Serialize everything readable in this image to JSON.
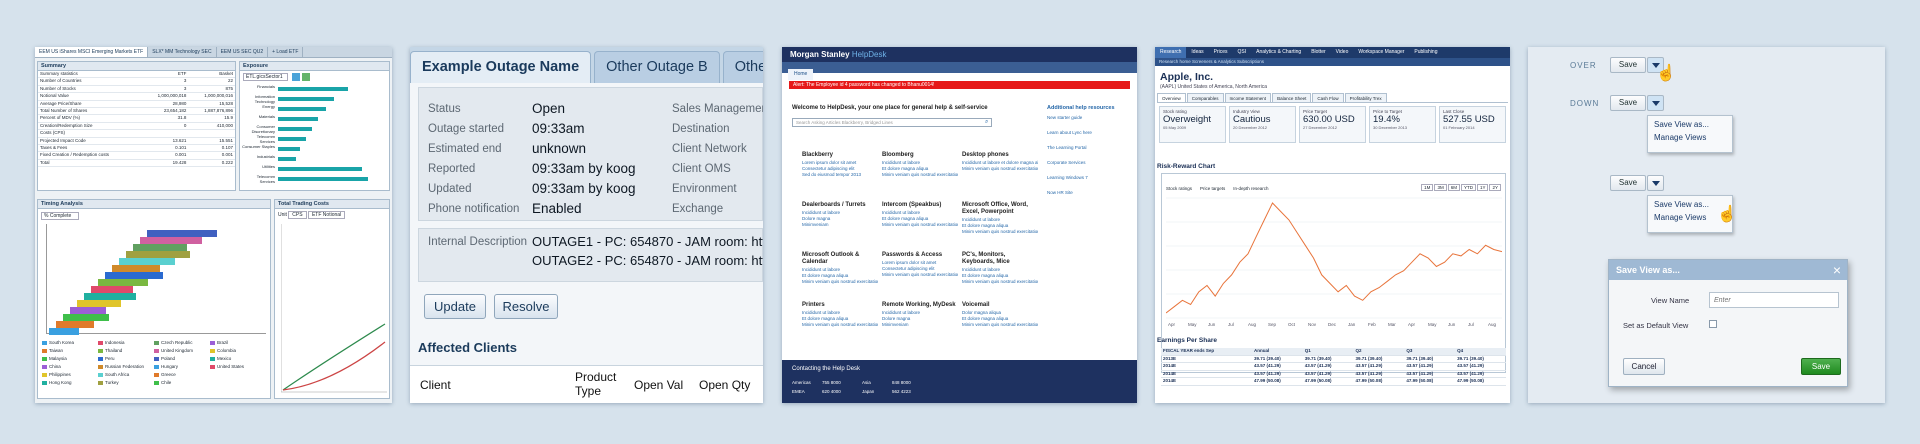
{
  "p1": {
    "tabs": [
      "EEM US iShares MSCI Emerging Markets ETF",
      "SLX* MM Technology SEC",
      "EEM US SEC QU2",
      "+ Load ETF"
    ],
    "summary": {
      "title": "Summary",
      "sub": "Summary statistics",
      "col1": "ETF",
      "col2": "Basket",
      "rows": [
        [
          "Number of Countries",
          "3",
          "22"
        ],
        [
          "Number of Stocks",
          "3",
          "875"
        ],
        [
          "Notional Value",
          "1,000,000,018",
          "1,000,000,016"
        ],
        [
          "Average Price/Share",
          "28,980",
          "15,528"
        ],
        [
          "Total Number of Shares",
          "23,654,182",
          "1,887,876,896"
        ],
        [
          "Percent of MDV (%)",
          "31.8",
          "15.9"
        ],
        [
          "Creation/Redemption Size",
          "0",
          "410,000"
        ],
        [
          "Costs (CPS)",
          "",
          ""
        ],
        [
          "Projected Impact Code",
          "13.621",
          "15.551"
        ],
        [
          "Taxes & Fees",
          "0.101",
          "0.107"
        ],
        [
          "Fixed Creation / Redemption costs",
          "0.001",
          "0.001"
        ],
        [
          "Total",
          "19.428",
          "0.222"
        ]
      ]
    },
    "exposure": {
      "title": "Exposure",
      "filter": "ETL.gicsSector1",
      "sectors": [
        "Financials",
        "Information Technology",
        "Energy",
        "Materials",
        "Consumer Discretionary",
        "Telecomm Services",
        "Consumer Staples",
        "Industrials",
        "Utilities",
        "Telecomm Services"
      ]
    },
    "timing": {
      "title": "Timing Analysis",
      "select": "% Complete"
    },
    "costs": {
      "title": "Total Trading Costs",
      "u1": "Unit",
      "u2": "CPS",
      "u3": "ETF Notional"
    },
    "legend": [
      "South Korea",
      "Taiwan",
      "Malaysia",
      "China",
      "Philippines",
      "Hong Kong",
      "Indonesia",
      "Thailand",
      "Peru",
      "Russian Federation",
      "South Africa",
      "Turkey",
      "Czech Republic",
      "United Kingdom",
      "Poland",
      "Hungary",
      "Greece",
      "Chile",
      "Brazil",
      "Colombia",
      "Mexico",
      "United States"
    ]
  },
  "p2": {
    "tabs": [
      "Example Outage Name",
      "Other Outage B",
      "Other Outage C"
    ],
    "fields": [
      {
        "k": "Status",
        "v": "Open"
      },
      {
        "k": "Outage started",
        "v": "09:33am"
      },
      {
        "k": "Estimated end",
        "v": "unknown"
      },
      {
        "k": "Reported",
        "v": "09:33am by koog"
      },
      {
        "k": "Updated",
        "v": "09:33am by koog"
      },
      {
        "k": "Phone notification",
        "v": "Enabled"
      }
    ],
    "right": [
      "Sales Management S",
      "Destination",
      "Client Network",
      "Client OMS",
      "Environment",
      "Exchange"
    ],
    "desc_label": "Internal Description",
    "desc1": "OUTAGE1 - PC: 654870 - JAM room: htt",
    "desc2": "OUTAGE2 - PC: 654870 - JAM room: htt",
    "update": "Update",
    "resolve": "Resolve",
    "affected": "Affected Clients",
    "cols": [
      "Client",
      "Product Type",
      "Open Val",
      "Open Qty"
    ]
  },
  "p3": {
    "brand": "Morgan Stanley",
    "brand2": "HelpDesk",
    "home": "Home",
    "alert": "Alert: The Employee id 4 password has changed to Bhanu0014!",
    "welcome": "Welcome to HelpDesk, your one place for general help & self-service",
    "search": "Search Asking Articles Blackberry, Bridged Lines",
    "cats": [
      {
        "t": "Blackberry",
        "l": [
          "Lorem ipsum dolor sit amet",
          "Consectetur adipiscing elit",
          "Sed do eiusmod tempor 2013"
        ]
      },
      {
        "t": "Bloomberg",
        "l": [
          "Incididunt ut labore",
          "Et dolore magna aliqua",
          "Minim veniam quis nostrud exercitation magna aliqua"
        ]
      },
      {
        "t": "Desktop phones",
        "l": [
          "Incididunt ut labore et dolore magna aliqua",
          "Minim veniam quis nostrud exercitation magna aliqua"
        ]
      },
      {
        "t": "Dealerboards / Turrets",
        "l": [
          "Incididunt ut labore",
          "Dolore magna",
          "Minimveniam"
        ]
      },
      {
        "t": "Intercom (Speakbus)",
        "l": [
          "Incididunt ut labore",
          "Et dolore magna aliqua",
          "Minim veniam quis nostrud exercitation magna aliqua"
        ]
      },
      {
        "t": "Microsoft Office, Word, Excel, Powerpoint",
        "l": [
          "Incididunt ut labore",
          "Et dolore magna aliqua",
          "Minim veniam quis nostrud exercitation magna aliqua"
        ]
      },
      {
        "t": "Microsoft Outlook & Calendar",
        "l": [
          "Incididunt ut labore",
          "Et dolore magna aliqua",
          "Minim veniam quis nostrud exercitation magna aliqua"
        ]
      },
      {
        "t": "Passwords & Access",
        "l": [
          "Lorem ipsum dolor sit amet",
          "Consectetur adipiscing elit",
          "Minim veniam quis nostrud exercitation magna aliqua"
        ]
      },
      {
        "t": "PC's, Monitors, Keyboards, Mice",
        "l": [
          "Incididunt ut labore",
          "Et dolore magna aliqua",
          "Minim veniam quis nostrud exercitation magna aliqua"
        ]
      },
      {
        "t": "Printers",
        "l": [
          "Incididunt ut labore",
          "Et dolore magna aliqua",
          "Minim veniam quis nostrud exercitation magna aliqua"
        ]
      },
      {
        "t": "Remote Working, MyDesk",
        "l": [
          "Incididunt ut labore",
          "Dolore magna",
          "Minimveniam"
        ]
      },
      {
        "t": "Voicemail",
        "l": [
          "Dolor magna aliqua",
          "Et dolore magna aliqua",
          "Minim veniam quis nostrud exercitation magna aliqua"
        ]
      }
    ],
    "side_head": "Additional help resources",
    "side_links": [
      "New starter guide",
      "Learn about Lync here",
      "The Learning Portal",
      "Corporate Services",
      "Learning Windows 7",
      "Now HR Site"
    ],
    "footer": "Contacting the Help Desk",
    "regions": [
      [
        "Americas",
        "755 8000"
      ],
      [
        "Asia",
        "848 8000"
      ],
      [
        "EMEA",
        "620 4000"
      ],
      [
        "Japan",
        "562 4223"
      ]
    ]
  },
  "p4": {
    "menu": [
      "Research",
      "Ideas",
      "Prices",
      "QSI",
      "Analytics & Charting",
      "Blotter",
      "Video",
      "Workspace Manager",
      "Publishing"
    ],
    "sub": "Research home   Screeners & Analytics   Subscriptions",
    "company": "Apple, Inc.",
    "company_sub": "(AAPL) United States of America, North America",
    "tabs": [
      "Overview",
      "Comparables",
      "Income Statement",
      "Balance Sheet",
      "Cash Flow",
      "Profitability Trex"
    ],
    "metrics": [
      {
        "l": "Stock rating",
        "v": "Overweight",
        "s": "05 May 2009"
      },
      {
        "l": "Industry View",
        "v": "Cautious",
        "s": "20 December 2012"
      },
      {
        "l": "Price Target",
        "v": "630.00 USD",
        "s": "27 December 2012"
      },
      {
        "l": "Price to Target",
        "v": "19.4%",
        "s": "30 December 2013"
      },
      {
        "l": "Last Close",
        "v": "527.55 USD",
        "s": "01 February 2014"
      }
    ],
    "rr": "Risk-Reward Chart",
    "opts": [
      "Stock ratings",
      "Price targets",
      "In-depth research"
    ],
    "ranges": [
      "1M",
      "3M",
      "6M",
      "YTD",
      "1Y",
      "2Y"
    ],
    "months": [
      "Apr",
      "May",
      "Jun",
      "Jul",
      "Aug",
      "Sep",
      "Oct",
      "Nov",
      "Dec",
      "Jan",
      "Feb",
      "Mar",
      "Apr",
      "May",
      "Jun",
      "Jul",
      "Aug"
    ],
    "eps": "Earnings Per Share",
    "eps_head": [
      "FISCAL YEAR ends Sep",
      "Annual",
      "Q1",
      "Q2",
      "Q3",
      "Q4"
    ],
    "eps_rows": [
      [
        "2013E",
        "39.71 (39.40)",
        "39.71 (39.40)",
        "39.71 (39.40)",
        "39.71 (39.40)",
        "39.71 (39.40)"
      ],
      [
        "2014E",
        "43.57 (41.29)",
        "43.57 (41.29)",
        "43.57 (41.29)",
        "43.57 (41.29)",
        "43.57 (41.29)"
      ],
      [
        "2014E",
        "43.57 (41.29)",
        "43.57 (41.29)",
        "43.57 (41.29)",
        "43.57 (41.29)",
        "43.57 (41.29)"
      ],
      [
        "2014E",
        "47.99 (50.08)",
        "47.99 (50.08)",
        "47.99 (50.08)",
        "47.99 (50.08)",
        "47.99 (50.08)"
      ]
    ]
  },
  "p6": {
    "over": "OVER",
    "down": "DOWN",
    "save": "Save",
    "m1": "Save View as...",
    "m2": "Manage Views",
    "dlg_title": "Save View as...",
    "view_name": "View Name",
    "placeholder": "Enter",
    "default": "Set as Default View",
    "cancel": "Cancel",
    "ok": "Save"
  },
  "colors": {
    "teal": "#19a4a8",
    "brand_navy": "#1e3160",
    "alert_red": "#e61919",
    "save_green": "#1f8a1f"
  },
  "price_series": [
    380,
    395,
    410,
    400,
    430,
    445,
    420,
    450,
    470,
    500,
    520,
    560,
    600,
    640,
    620,
    600,
    570,
    540,
    510,
    470,
    450,
    430,
    445,
    420,
    410,
    430,
    440,
    455,
    470,
    480,
    500,
    520,
    510,
    490,
    500,
    520,
    515,
    530,
    520,
    540,
    530,
    525
  ]
}
